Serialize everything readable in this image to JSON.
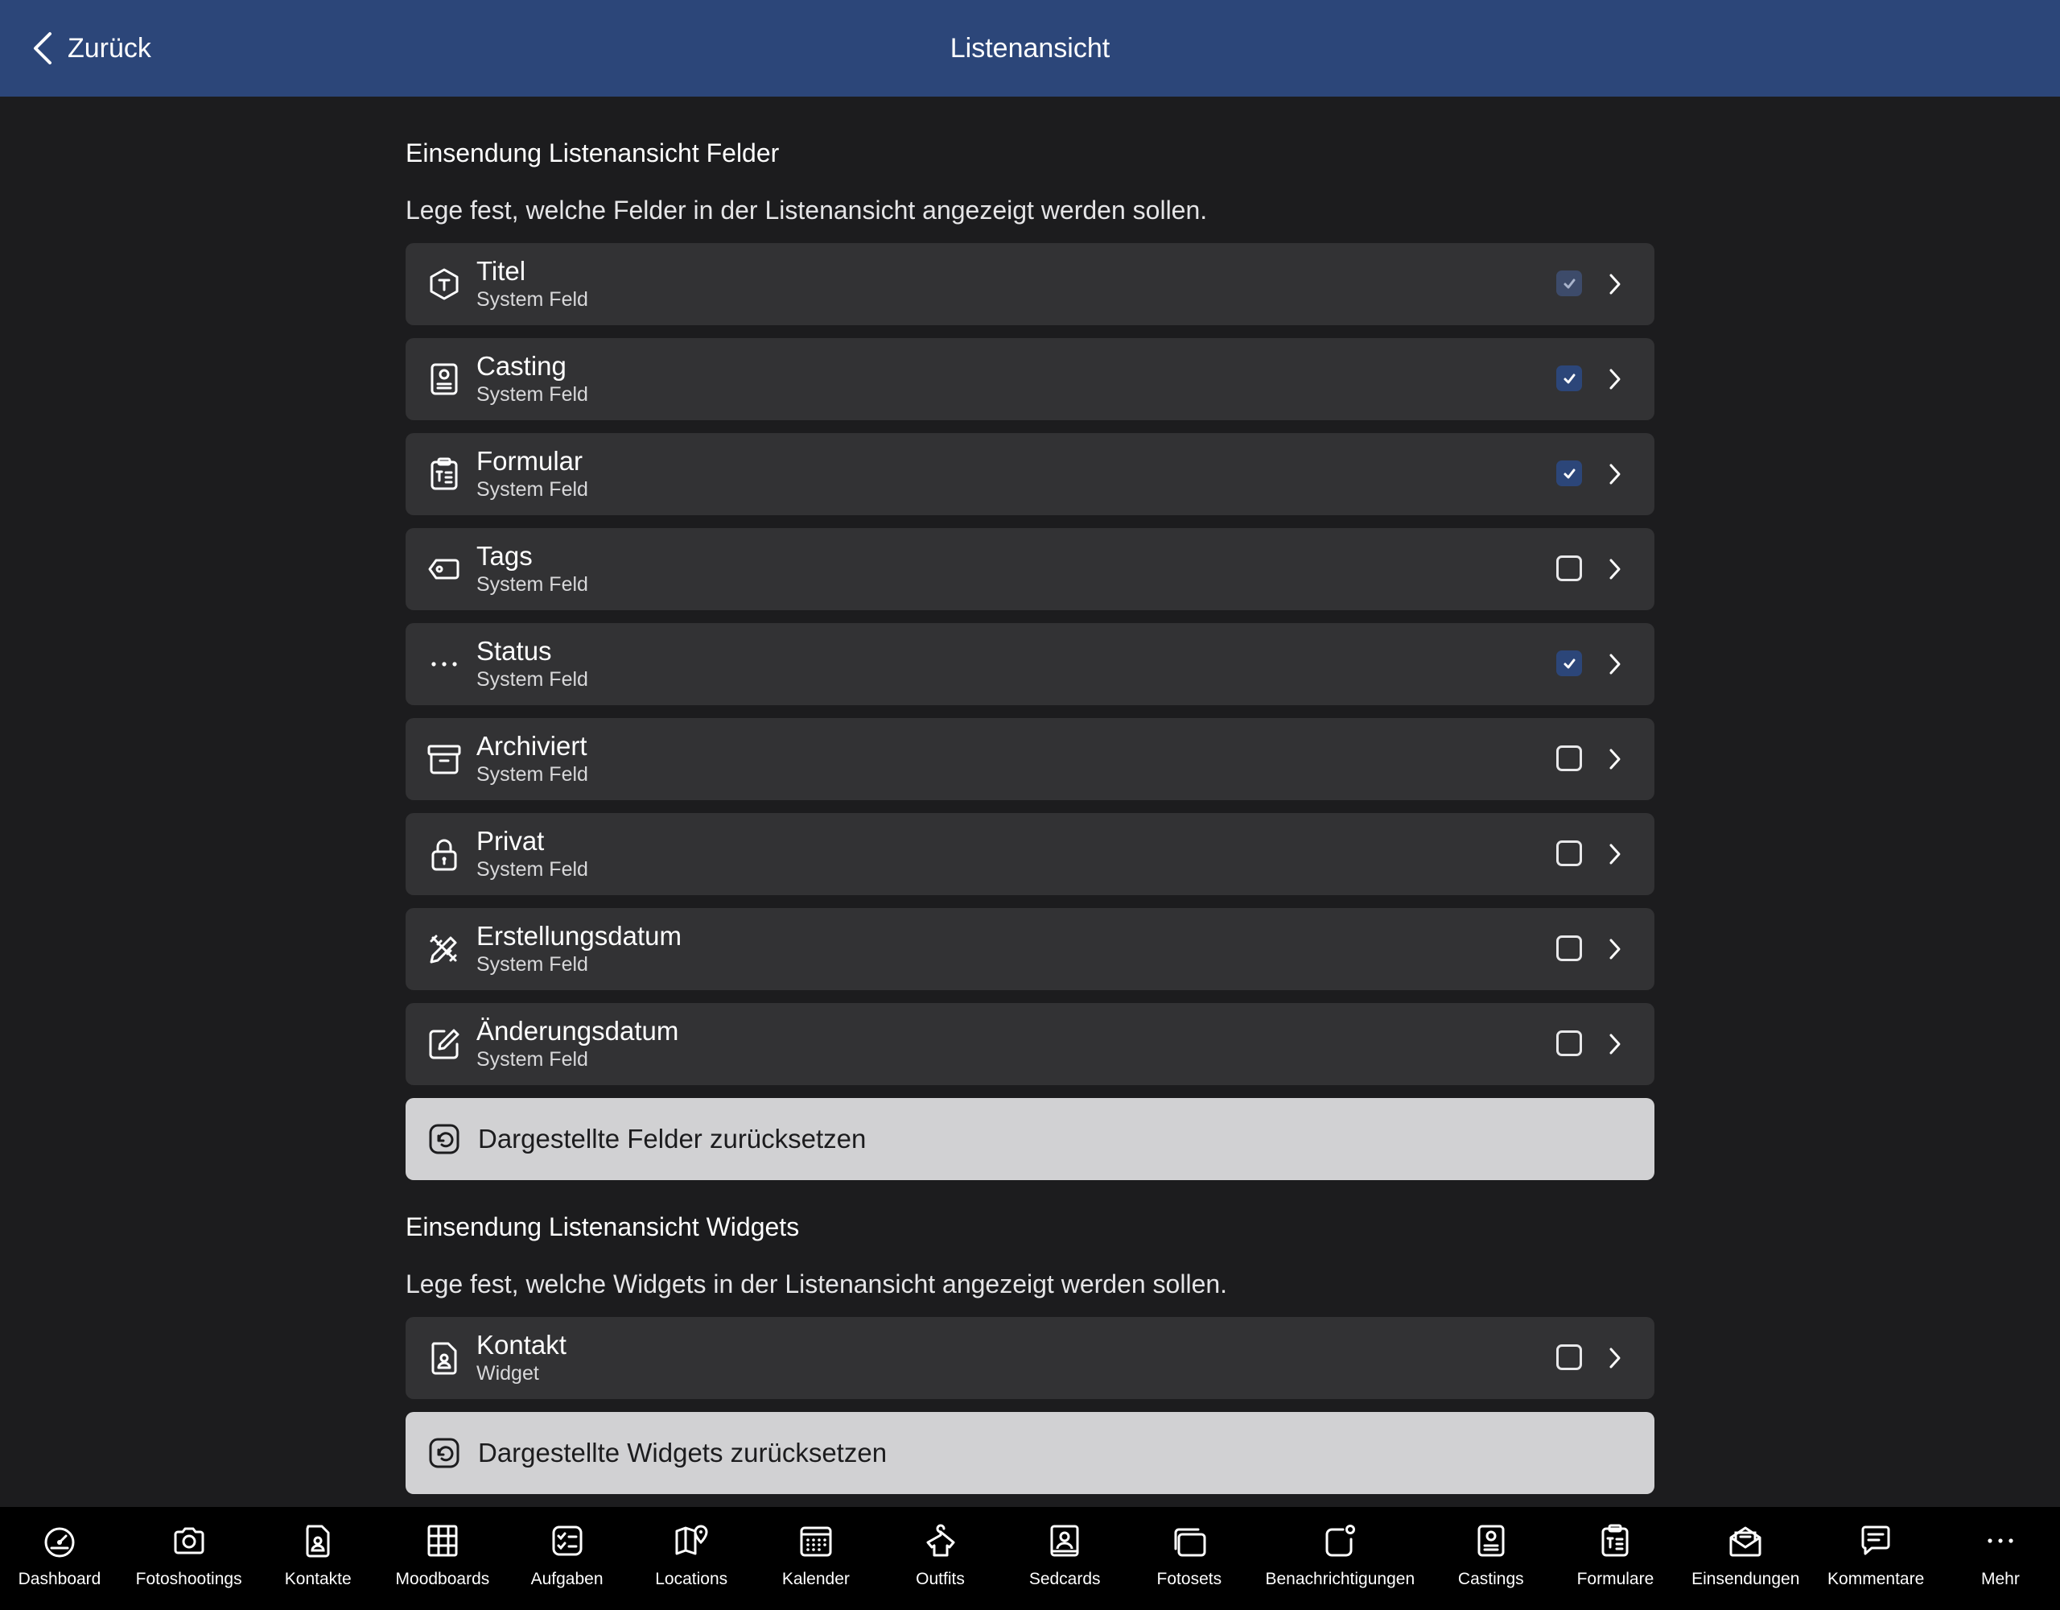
{
  "header": {
    "back_label": "Zurück",
    "title": "Listenansicht"
  },
  "fields_section": {
    "title": "Einsendung Listenansicht Felder",
    "description": "Lege fest, welche Felder in der Listenansicht angezeigt werden sollen.",
    "items": [
      {
        "title": "Titel",
        "subtitle": "System Feld",
        "icon": "title-hexagon-icon",
        "checked": true,
        "disabled": true
      },
      {
        "title": "Casting",
        "subtitle": "System Feld",
        "icon": "casting-card-icon",
        "checked": true
      },
      {
        "title": "Formular",
        "subtitle": "System Feld",
        "icon": "clipboard-list-icon",
        "checked": true
      },
      {
        "title": "Tags",
        "subtitle": "System Feld",
        "icon": "tag-icon",
        "checked": false
      },
      {
        "title": "Status",
        "subtitle": "System Feld",
        "icon": "dots-icon",
        "checked": true
      },
      {
        "title": "Archiviert",
        "subtitle": "System Feld",
        "icon": "archive-box-icon",
        "checked": false
      },
      {
        "title": "Privat",
        "subtitle": "System Feld",
        "icon": "lock-icon",
        "checked": false
      },
      {
        "title": "Erstellungsdatum",
        "subtitle": "System Feld",
        "icon": "pencil-ruler-icon",
        "checked": false
      },
      {
        "title": "Änderungsdatum",
        "subtitle": "System Feld",
        "icon": "edit-square-icon",
        "checked": false
      }
    ],
    "reset_label": "Dargestellte Felder zurücksetzen"
  },
  "widgets_section": {
    "title": "Einsendung Listenansicht Widgets",
    "description": "Lege fest, welche Widgets in der Listenansicht angezeigt werden sollen.",
    "items": [
      {
        "title": "Kontakt",
        "subtitle": "Widget",
        "icon": "contact-file-icon",
        "checked": false
      }
    ],
    "reset_label": "Dargestellte Widgets zurücksetzen"
  },
  "tabbar": [
    {
      "label": "Dashboard",
      "icon": "gauge-icon"
    },
    {
      "label": "Fotoshootings",
      "icon": "camera-icon"
    },
    {
      "label": "Kontakte",
      "icon": "contact-file-icon"
    },
    {
      "label": "Moodboards",
      "icon": "grid-board-icon"
    },
    {
      "label": "Aufgaben",
      "icon": "checklist-icon"
    },
    {
      "label": "Locations",
      "icon": "map-pin-icon"
    },
    {
      "label": "Kalender",
      "icon": "calendar-icon"
    },
    {
      "label": "Outfits",
      "icon": "shirt-hanger-icon"
    },
    {
      "label": "Sedcards",
      "icon": "person-card-icon"
    },
    {
      "label": "Fotosets",
      "icon": "photo-stack-icon"
    },
    {
      "label": "Benachrichtigungen",
      "icon": "notification-icon"
    },
    {
      "label": "Castings",
      "icon": "casting-card-icon"
    },
    {
      "label": "Formulare",
      "icon": "clipboard-list-icon"
    },
    {
      "label": "Einsendungen",
      "icon": "envelope-open-icon"
    },
    {
      "label": "Kommentare",
      "icon": "comment-icon"
    },
    {
      "label": "Mehr",
      "icon": "more-dots-icon"
    }
  ]
}
